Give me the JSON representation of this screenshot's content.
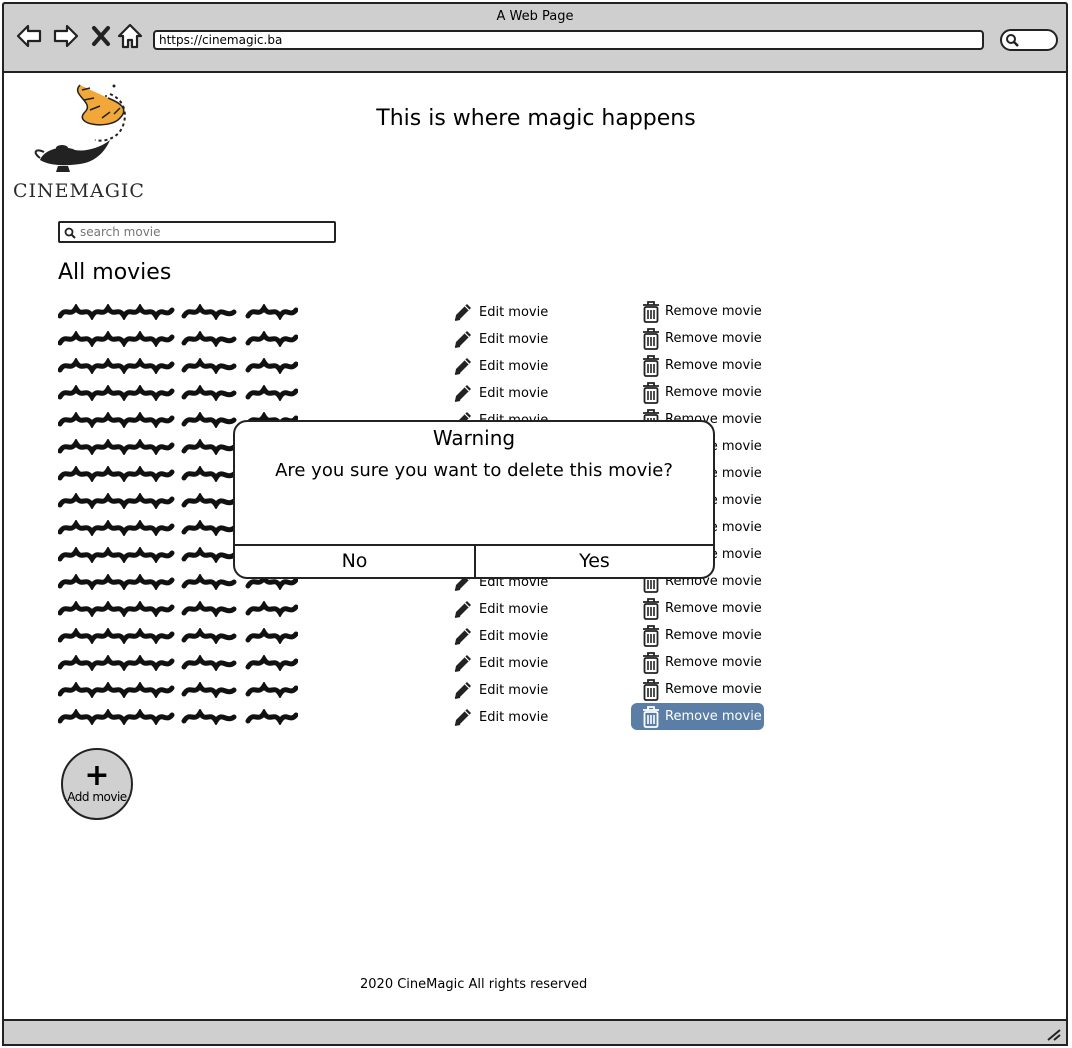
{
  "window": {
    "title": "A Web Page",
    "url": "https://cinemagic.ba"
  },
  "header": {
    "logo_text": "CINEMAGIC",
    "tagline": "This is where magic happens"
  },
  "search": {
    "placeholder": "search movie"
  },
  "movies": {
    "title": "All movies",
    "edit_label": "Edit movie",
    "remove_label": "Remove movie",
    "row_count": 16,
    "selected_row": 16
  },
  "add_button": {
    "label": "Add movie"
  },
  "dialog": {
    "title": "Warning",
    "message": "Are you sure you want to delete this movie?",
    "no_label": "No",
    "yes_label": "Yes"
  },
  "footer": {
    "text": "2020 CineMagic All rights reserved"
  },
  "colors": {
    "chrome": "#cfcfcf",
    "selected": "#5b7ea6"
  },
  "icons": [
    "back-icon",
    "forward-icon",
    "stop-icon",
    "home-icon",
    "search-icon",
    "pencil-icon",
    "trash-icon",
    "plus-icon"
  ]
}
